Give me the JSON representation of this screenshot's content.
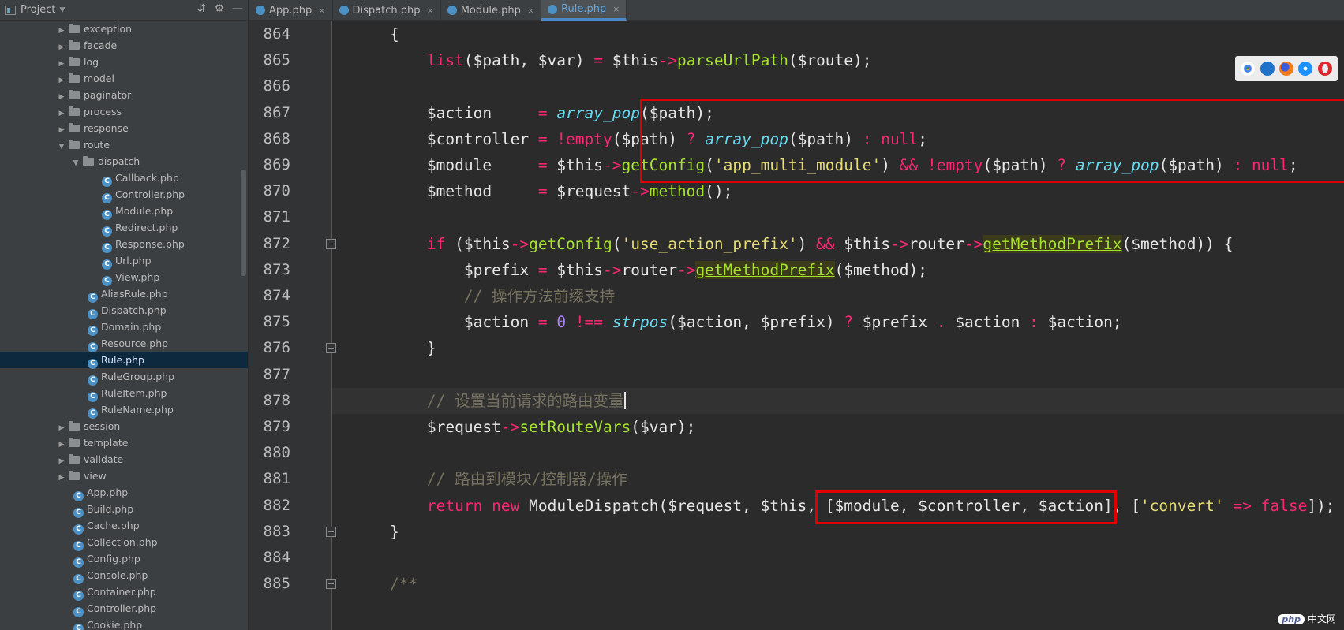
{
  "sidebar": {
    "title": "Project",
    "tree": [
      {
        "type": "folder",
        "label": "exception",
        "indent": 1,
        "open": false
      },
      {
        "type": "folder",
        "label": "facade",
        "indent": 1,
        "open": false
      },
      {
        "type": "folder",
        "label": "log",
        "indent": 1,
        "open": false
      },
      {
        "type": "folder",
        "label": "model",
        "indent": 1,
        "open": false
      },
      {
        "type": "folder",
        "label": "paginator",
        "indent": 1,
        "open": false
      },
      {
        "type": "folder",
        "label": "process",
        "indent": 1,
        "open": false
      },
      {
        "type": "folder",
        "label": "response",
        "indent": 1,
        "open": false
      },
      {
        "type": "folder",
        "label": "route",
        "indent": 1,
        "open": true
      },
      {
        "type": "folder",
        "label": "dispatch",
        "indent": 2,
        "open": true
      },
      {
        "type": "file",
        "label": "Callback.php",
        "indent": 3
      },
      {
        "type": "file",
        "label": "Controller.php",
        "indent": 3
      },
      {
        "type": "file",
        "label": "Module.php",
        "indent": 3
      },
      {
        "type": "file",
        "label": "Redirect.php",
        "indent": 3
      },
      {
        "type": "file",
        "label": "Response.php",
        "indent": 3
      },
      {
        "type": "file",
        "label": "Url.php",
        "indent": 3
      },
      {
        "type": "file",
        "label": "View.php",
        "indent": 3
      },
      {
        "type": "file",
        "label": "AliasRule.php",
        "indent": 2
      },
      {
        "type": "file",
        "label": "Dispatch.php",
        "indent": 2
      },
      {
        "type": "file",
        "label": "Domain.php",
        "indent": 2
      },
      {
        "type": "file",
        "label": "Resource.php",
        "indent": 2
      },
      {
        "type": "file",
        "label": "Rule.php",
        "indent": 2,
        "selected": true
      },
      {
        "type": "file",
        "label": "RuleGroup.php",
        "indent": 2
      },
      {
        "type": "file",
        "label": "RuleItem.php",
        "indent": 2
      },
      {
        "type": "file",
        "label": "RuleName.php",
        "indent": 2
      },
      {
        "type": "folder",
        "label": "session",
        "indent": 1,
        "open": false
      },
      {
        "type": "folder",
        "label": "template",
        "indent": 1,
        "open": false
      },
      {
        "type": "folder",
        "label": "validate",
        "indent": 1,
        "open": false
      },
      {
        "type": "folder",
        "label": "view",
        "indent": 1,
        "open": false
      },
      {
        "type": "file",
        "label": "App.php",
        "indent": 1
      },
      {
        "type": "file",
        "label": "Build.php",
        "indent": 1
      },
      {
        "type": "file",
        "label": "Cache.php",
        "indent": 1
      },
      {
        "type": "file",
        "label": "Collection.php",
        "indent": 1
      },
      {
        "type": "file",
        "label": "Config.php",
        "indent": 1
      },
      {
        "type": "file",
        "label": "Console.php",
        "indent": 1
      },
      {
        "type": "file",
        "label": "Container.php",
        "indent": 1
      },
      {
        "type": "file",
        "label": "Controller.php",
        "indent": 1
      },
      {
        "type": "file",
        "label": "Cookie.php",
        "indent": 1
      }
    ]
  },
  "tabs": [
    {
      "label": "App.php",
      "active": false
    },
    {
      "label": "Dispatch.php",
      "active": false
    },
    {
      "label": "Module.php",
      "active": false
    },
    {
      "label": "Rule.php",
      "active": true
    }
  ],
  "editor": {
    "line_numbers": [
      "864",
      "865",
      "866",
      "867",
      "868",
      "869",
      "870",
      "871",
      "872",
      "873",
      "874",
      "875",
      "876",
      "877",
      "878",
      "879",
      "880",
      "881",
      "882",
      "883",
      "884",
      "885"
    ],
    "lines": [
      [
        {
          "t": "    {"
        }
      ],
      [
        {
          "t": "        "
        },
        {
          "t": "list",
          "c": "kw"
        },
        {
          "t": "($path, $var) "
        },
        {
          "t": "=",
          "c": "op"
        },
        {
          "t": " $this"
        },
        {
          "t": "->",
          "c": "op"
        },
        {
          "t": "parseUrlPath",
          "c": "fn"
        },
        {
          "t": "($route);"
        }
      ],
      [
        {
          "t": ""
        }
      ],
      [
        {
          "t": "        $action     "
        },
        {
          "t": "=",
          "c": "op"
        },
        {
          "t": " "
        },
        {
          "t": "array_pop",
          "c": "ifn"
        },
        {
          "t": "($path);"
        }
      ],
      [
        {
          "t": "        $controller "
        },
        {
          "t": "=",
          "c": "op"
        },
        {
          "t": " "
        },
        {
          "t": "!empty",
          "c": "kw"
        },
        {
          "t": "($path) "
        },
        {
          "t": "?",
          "c": "op"
        },
        {
          "t": " "
        },
        {
          "t": "array_pop",
          "c": "ifn"
        },
        {
          "t": "($path) "
        },
        {
          "t": ":",
          "c": "op"
        },
        {
          "t": " "
        },
        {
          "t": "null",
          "c": "kw"
        },
        {
          "t": ";"
        }
      ],
      [
        {
          "t": "        $module     "
        },
        {
          "t": "=",
          "c": "op"
        },
        {
          "t": " $this"
        },
        {
          "t": "->",
          "c": "op"
        },
        {
          "t": "getConfig",
          "c": "fn"
        },
        {
          "t": "("
        },
        {
          "t": "'app_multi_module'",
          "c": "str"
        },
        {
          "t": ") "
        },
        {
          "t": "&&",
          "c": "op"
        },
        {
          "t": " "
        },
        {
          "t": "!empty",
          "c": "kw"
        },
        {
          "t": "($path) "
        },
        {
          "t": "?",
          "c": "op"
        },
        {
          "t": " "
        },
        {
          "t": "array_pop",
          "c": "ifn"
        },
        {
          "t": "($path) "
        },
        {
          "t": ":",
          "c": "op"
        },
        {
          "t": " "
        },
        {
          "t": "null",
          "c": "kw"
        },
        {
          "t": ";"
        }
      ],
      [
        {
          "t": "        $method     "
        },
        {
          "t": "=",
          "c": "op"
        },
        {
          "t": " $request"
        },
        {
          "t": "->",
          "c": "op"
        },
        {
          "t": "method",
          "c": "fn"
        },
        {
          "t": "();"
        }
      ],
      [
        {
          "t": ""
        }
      ],
      [
        {
          "t": "        "
        },
        {
          "t": "if",
          "c": "kw"
        },
        {
          "t": " ($this"
        },
        {
          "t": "->",
          "c": "op"
        },
        {
          "t": "getConfig",
          "c": "fn"
        },
        {
          "t": "("
        },
        {
          "t": "'use_action_prefix'",
          "c": "str"
        },
        {
          "t": ") "
        },
        {
          "t": "&&",
          "c": "op"
        },
        {
          "t": " $this"
        },
        {
          "t": "->",
          "c": "op"
        },
        {
          "t": "router"
        },
        {
          "t": "->",
          "c": "op"
        },
        {
          "t": "getMethodPrefix",
          "c": "hl"
        },
        {
          "t": "($method)) {"
        }
      ],
      [
        {
          "t": "            $prefix "
        },
        {
          "t": "=",
          "c": "op"
        },
        {
          "t": " $this"
        },
        {
          "t": "->",
          "c": "op"
        },
        {
          "t": "router"
        },
        {
          "t": "->",
          "c": "op"
        },
        {
          "t": "getMethodPrefix",
          "c": "hl"
        },
        {
          "t": "($method);"
        }
      ],
      [
        {
          "t": "            "
        },
        {
          "t": "// 操作方法前缀支持",
          "c": "cm"
        }
      ],
      [
        {
          "t": "            $action "
        },
        {
          "t": "=",
          "c": "op"
        },
        {
          "t": " "
        },
        {
          "t": "0",
          "c": "num"
        },
        {
          "t": " "
        },
        {
          "t": "!==",
          "c": "op"
        },
        {
          "t": " "
        },
        {
          "t": "strpos",
          "c": "ifn"
        },
        {
          "t": "($action, $prefix) "
        },
        {
          "t": "?",
          "c": "op"
        },
        {
          "t": " $prefix "
        },
        {
          "t": ".",
          "c": "op"
        },
        {
          "t": " $action "
        },
        {
          "t": ":",
          "c": "op"
        },
        {
          "t": " $action;"
        }
      ],
      [
        {
          "t": "        }"
        }
      ],
      [
        {
          "t": ""
        }
      ],
      [
        {
          "t": "        "
        },
        {
          "t": "// 设置当前请求的路由变量",
          "c": "cm"
        },
        {
          "t": "",
          "caret": true
        }
      ],
      [
        {
          "t": "        $request"
        },
        {
          "t": "->",
          "c": "op"
        },
        {
          "t": "setRouteVars",
          "c": "fn"
        },
        {
          "t": "($var);"
        }
      ],
      [
        {
          "t": ""
        }
      ],
      [
        {
          "t": "        "
        },
        {
          "t": "// 路由到模块/控制器/操作",
          "c": "cm"
        }
      ],
      [
        {
          "t": "        "
        },
        {
          "t": "return",
          "c": "kw"
        },
        {
          "t": " "
        },
        {
          "t": "new",
          "c": "kw"
        },
        {
          "t": " ModuleDispatch($request, $this, [$module, $controller, $action], ["
        },
        {
          "t": "'convert'",
          "c": "str"
        },
        {
          "t": " "
        },
        {
          "t": "=>",
          "c": "op"
        },
        {
          "t": " "
        },
        {
          "t": "false",
          "c": "kw"
        },
        {
          "t": "]);"
        }
      ],
      [
        {
          "t": "    }"
        }
      ],
      [
        {
          "t": ""
        }
      ],
      [
        {
          "t": "    "
        },
        {
          "t": "/**",
          "c": "cm"
        }
      ]
    ]
  },
  "colors": {
    "accent": "#4a88c7",
    "highlight_box": "#e00000"
  },
  "watermark": {
    "logo": "php",
    "text": "中文网"
  },
  "browser_icons": [
    "chrome-icon",
    "edge-icon",
    "firefox-icon",
    "safari-icon",
    "opera-icon"
  ]
}
